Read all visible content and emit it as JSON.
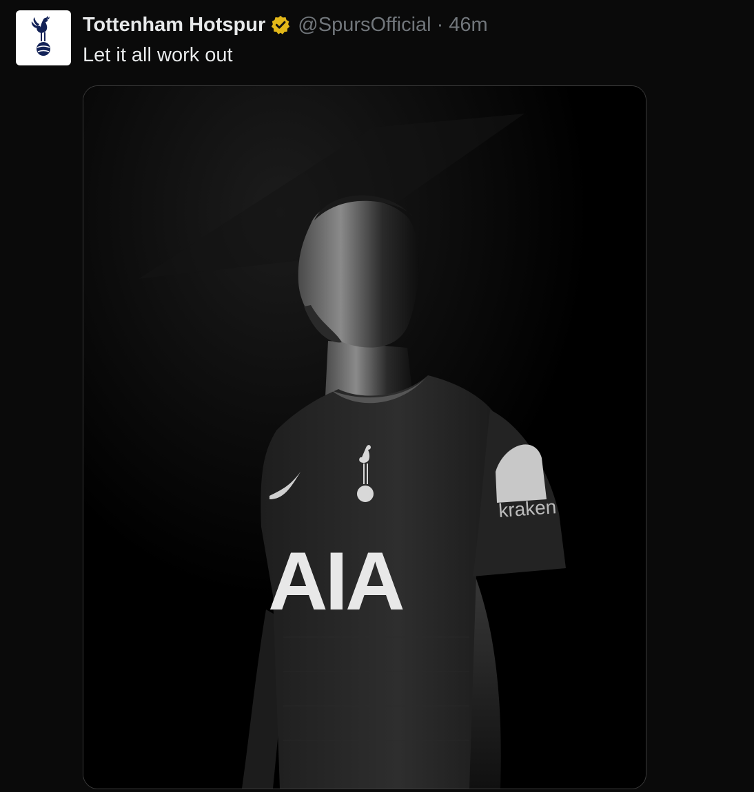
{
  "tweet": {
    "display_name": "Tottenham Hotspur",
    "verified_icon": "verified-badge-gold",
    "handle": "@SpursOfficial",
    "separator": "·",
    "timestamp": "46m",
    "text": "Let it all work out",
    "avatar_icon": "spurs-cockerel-crest",
    "media": {
      "shirt_sponsor": "AIA",
      "sleeve_sponsor": "kraken"
    }
  },
  "colors": {
    "background": "#0a0a0a",
    "text_primary": "#e7e9ea",
    "text_secondary": "#71767b",
    "verified_gold": "#e2b719",
    "spurs_navy": "#132257"
  }
}
